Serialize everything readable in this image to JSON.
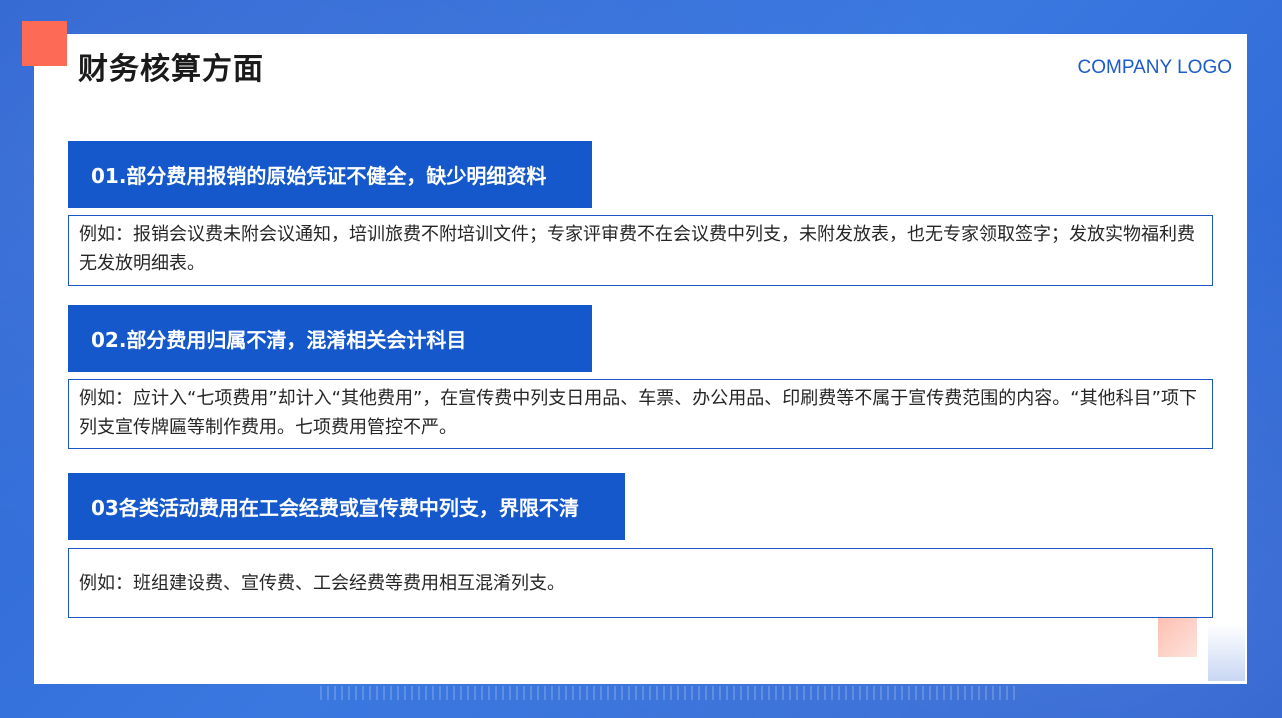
{
  "slide": {
    "title": "财务核算方面",
    "logo_text": "COMPANY LOGO"
  },
  "sections": [
    {
      "heading": "01.部分费用报销的原始凭证不健全，缺少明细资料",
      "body": "例如：报销会议费未附会议通知，培训旅费不附培训文件；专家评审费不在会议费中列支，未附发放表，也无专家领取签字；发放实物福利费无发放明细表。"
    },
    {
      "heading": "02.部分费用归属不清，混淆相关会计科目",
      "body": "例如：应计入“七项费用”却计入“其他费用”，在宣传费中列支日用品、车票、办公用品、印刷费等不属于宣传费范围的内容。“其他科目”项下列支宣传牌匾等制作费用。七项费用管控不严。"
    },
    {
      "heading": "03各类活动费用在工会经费或宣传费中列支，界限不清",
      "body": "例如：班组建设费、宣传费、工会经费等费用相互混淆列支。"
    }
  ],
  "colors": {
    "accent": "#fd6a55",
    "primary": "#1458cc",
    "background": "#2f6ad8"
  }
}
